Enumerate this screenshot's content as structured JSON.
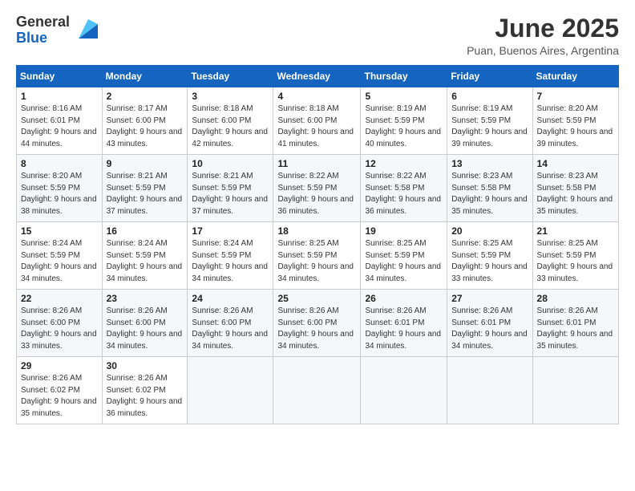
{
  "header": {
    "logo_general": "General",
    "logo_blue": "Blue",
    "month": "June 2025",
    "location": "Puan, Buenos Aires, Argentina"
  },
  "weekdays": [
    "Sunday",
    "Monday",
    "Tuesday",
    "Wednesday",
    "Thursday",
    "Friday",
    "Saturday"
  ],
  "weeks": [
    [
      {
        "day": "1",
        "sunrise": "8:16 AM",
        "sunset": "6:01 PM",
        "daylight": "9 hours and 44 minutes."
      },
      {
        "day": "2",
        "sunrise": "8:17 AM",
        "sunset": "6:00 PM",
        "daylight": "9 hours and 43 minutes."
      },
      {
        "day": "3",
        "sunrise": "8:18 AM",
        "sunset": "6:00 PM",
        "daylight": "9 hours and 42 minutes."
      },
      {
        "day": "4",
        "sunrise": "8:18 AM",
        "sunset": "6:00 PM",
        "daylight": "9 hours and 41 minutes."
      },
      {
        "day": "5",
        "sunrise": "8:19 AM",
        "sunset": "5:59 PM",
        "daylight": "9 hours and 40 minutes."
      },
      {
        "day": "6",
        "sunrise": "8:19 AM",
        "sunset": "5:59 PM",
        "daylight": "9 hours and 39 minutes."
      },
      {
        "day": "7",
        "sunrise": "8:20 AM",
        "sunset": "5:59 PM",
        "daylight": "9 hours and 39 minutes."
      }
    ],
    [
      {
        "day": "8",
        "sunrise": "8:20 AM",
        "sunset": "5:59 PM",
        "daylight": "9 hours and 38 minutes."
      },
      {
        "day": "9",
        "sunrise": "8:21 AM",
        "sunset": "5:59 PM",
        "daylight": "9 hours and 37 minutes."
      },
      {
        "day": "10",
        "sunrise": "8:21 AM",
        "sunset": "5:59 PM",
        "daylight": "9 hours and 37 minutes."
      },
      {
        "day": "11",
        "sunrise": "8:22 AM",
        "sunset": "5:59 PM",
        "daylight": "9 hours and 36 minutes."
      },
      {
        "day": "12",
        "sunrise": "8:22 AM",
        "sunset": "5:58 PM",
        "daylight": "9 hours and 36 minutes."
      },
      {
        "day": "13",
        "sunrise": "8:23 AM",
        "sunset": "5:58 PM",
        "daylight": "9 hours and 35 minutes."
      },
      {
        "day": "14",
        "sunrise": "8:23 AM",
        "sunset": "5:58 PM",
        "daylight": "9 hours and 35 minutes."
      }
    ],
    [
      {
        "day": "15",
        "sunrise": "8:24 AM",
        "sunset": "5:59 PM",
        "daylight": "9 hours and 34 minutes."
      },
      {
        "day": "16",
        "sunrise": "8:24 AM",
        "sunset": "5:59 PM",
        "daylight": "9 hours and 34 minutes."
      },
      {
        "day": "17",
        "sunrise": "8:24 AM",
        "sunset": "5:59 PM",
        "daylight": "9 hours and 34 minutes."
      },
      {
        "day": "18",
        "sunrise": "8:25 AM",
        "sunset": "5:59 PM",
        "daylight": "9 hours and 34 minutes."
      },
      {
        "day": "19",
        "sunrise": "8:25 AM",
        "sunset": "5:59 PM",
        "daylight": "9 hours and 34 minutes."
      },
      {
        "day": "20",
        "sunrise": "8:25 AM",
        "sunset": "5:59 PM",
        "daylight": "9 hours and 33 minutes."
      },
      {
        "day": "21",
        "sunrise": "8:25 AM",
        "sunset": "5:59 PM",
        "daylight": "9 hours and 33 minutes."
      }
    ],
    [
      {
        "day": "22",
        "sunrise": "8:26 AM",
        "sunset": "6:00 PM",
        "daylight": "9 hours and 33 minutes."
      },
      {
        "day": "23",
        "sunrise": "8:26 AM",
        "sunset": "6:00 PM",
        "daylight": "9 hours and 34 minutes."
      },
      {
        "day": "24",
        "sunrise": "8:26 AM",
        "sunset": "6:00 PM",
        "daylight": "9 hours and 34 minutes."
      },
      {
        "day": "25",
        "sunrise": "8:26 AM",
        "sunset": "6:00 PM",
        "daylight": "9 hours and 34 minutes."
      },
      {
        "day": "26",
        "sunrise": "8:26 AM",
        "sunset": "6:01 PM",
        "daylight": "9 hours and 34 minutes."
      },
      {
        "day": "27",
        "sunrise": "8:26 AM",
        "sunset": "6:01 PM",
        "daylight": "9 hours and 34 minutes."
      },
      {
        "day": "28",
        "sunrise": "8:26 AM",
        "sunset": "6:01 PM",
        "daylight": "9 hours and 35 minutes."
      }
    ],
    [
      {
        "day": "29",
        "sunrise": "8:26 AM",
        "sunset": "6:02 PM",
        "daylight": "9 hours and 35 minutes."
      },
      {
        "day": "30",
        "sunrise": "8:26 AM",
        "sunset": "6:02 PM",
        "daylight": "9 hours and 36 minutes."
      },
      null,
      null,
      null,
      null,
      null
    ]
  ]
}
